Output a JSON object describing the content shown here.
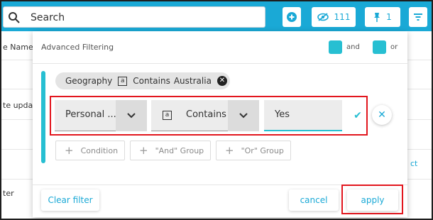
{
  "topbar": {
    "search_placeholder": "Search",
    "hidden_count": "111",
    "pinned_count": "1",
    "accent": "#1aa9d6"
  },
  "background": {
    "column_header": "e Name",
    "rows": [
      "te updat",
      "ter"
    ],
    "right_link": "ct"
  },
  "panel": {
    "title": "Advanced Filtering",
    "legend": [
      {
        "label": "and",
        "color": "#27bfd2"
      },
      {
        "label": "or",
        "color": "#27bfd2"
      }
    ],
    "existing_condition": {
      "field": "Geography",
      "operator": "Contains",
      "value": "Australia"
    },
    "new_condition": {
      "field": "Personal ...",
      "operator": "Contains",
      "value": "Yes"
    },
    "add_buttons": {
      "condition": "Condition",
      "and_group": "\"And\" Group",
      "or_group": "\"Or\" Group"
    },
    "footer": {
      "clear": "Clear filter",
      "cancel": "cancel",
      "apply": "apply"
    },
    "highlight_color": "#e2161e"
  }
}
